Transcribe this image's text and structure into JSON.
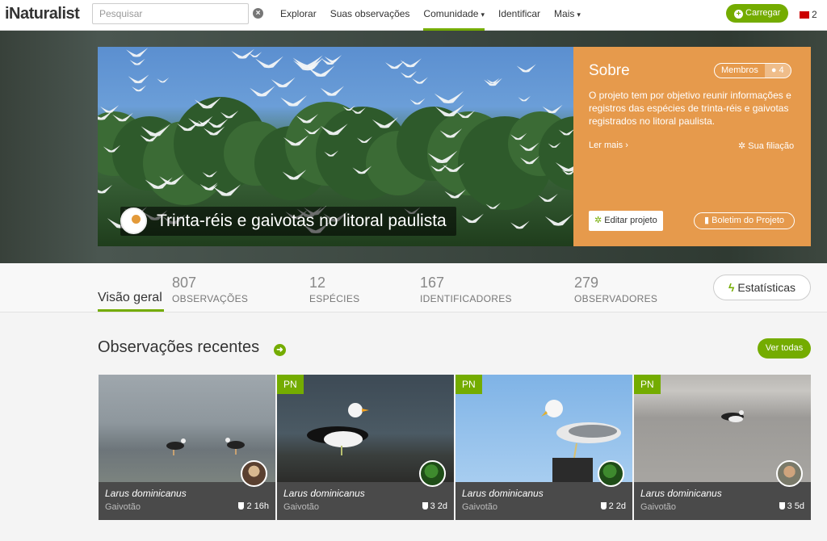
{
  "header": {
    "logo": "iNaturalist",
    "search_placeholder": "Pesquisar",
    "nav": [
      "Explorar",
      "Suas observações",
      "Comunidade",
      "Identificar",
      "Mais"
    ],
    "upload": "Carregar",
    "messages_count": "2"
  },
  "project": {
    "title": "Trinta-réis e gaivotas no litoral paulista",
    "about_title": "Sobre",
    "members_label": "Membros",
    "members_count": "4",
    "description": "O projeto tem por objetivo reunir informações e registros das espécies de trinta-réis e gaivotas registrados no litoral paulista.",
    "read_more": "Ler mais",
    "membership": "Sua filiação",
    "edit": "Editar projeto",
    "journal": "Boletim do Projeto"
  },
  "stats": {
    "overview": "Visão geral",
    "items": [
      {
        "num": "807",
        "label": "OBSERVAÇÕES"
      },
      {
        "num": "12",
        "label": "ESPÉCIES"
      },
      {
        "num": "167",
        "label": "IDENTIFICADORES"
      },
      {
        "num": "279",
        "label": "OBSERVADORES"
      }
    ],
    "stats_button": "Estatísticas"
  },
  "recent": {
    "title": "Observações recentes",
    "view_all": "Ver todas",
    "cards": [
      {
        "badge": "",
        "sci": "Larus dominicanus",
        "common": "Gaivotão",
        "ids": "2",
        "age": "16h"
      },
      {
        "badge": "PN",
        "sci": "Larus dominicanus",
        "common": "Gaivotão",
        "ids": "3",
        "age": "2d"
      },
      {
        "badge": "PN",
        "sci": "Larus dominicanus",
        "common": "Gaivotão",
        "ids": "2",
        "age": "2d"
      },
      {
        "badge": "PN",
        "sci": "Larus dominicanus",
        "common": "Gaivotão",
        "ids": "3",
        "age": "5d"
      }
    ]
  },
  "colors": {
    "brand": "#74ac00",
    "about_bg": "#e69a4c"
  }
}
